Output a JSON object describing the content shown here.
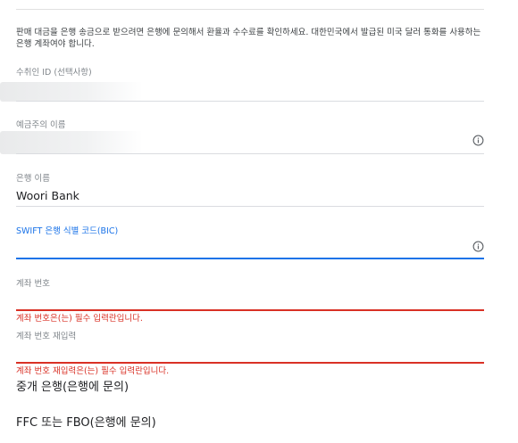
{
  "description": "판매 대금을 은행 송금으로 받으려면 은행에 문의해서 환율과 수수료를 확인하세요. 대한민국에서 발급된 미국 달러 통화를 사용하는 은행 계좌여야 합니다.",
  "fields": {
    "recipient_id": {
      "label": "수취인 ID (선택사항)",
      "value": ""
    },
    "account_holder": {
      "label": "예금주의 이름",
      "value": ""
    },
    "bank_name": {
      "label": "은행 이름",
      "value": "Woori Bank"
    },
    "swift_code": {
      "label": "SWIFT 은행 식별 코드(BIC)",
      "value": ""
    },
    "account_number": {
      "label": "계좌 번호",
      "value": "",
      "error": "계좌 번호은(는) 필수 입력란입니다."
    },
    "account_number_confirm": {
      "label": "계좌 번호 재입력",
      "value": "",
      "error": "계좌 번호 재입력은(는) 필수 입력란입니다."
    }
  },
  "sections": {
    "intermediary_bank": "중개 은행(은행에 문의)",
    "ffc_fbo": "FFC 또는 FBO(은행에 문의)"
  },
  "colors": {
    "accent": "#1a73e8",
    "error": "#d93025",
    "label": "#80868b",
    "divider": "#dadce0"
  },
  "icons": {
    "info": "info-icon"
  }
}
